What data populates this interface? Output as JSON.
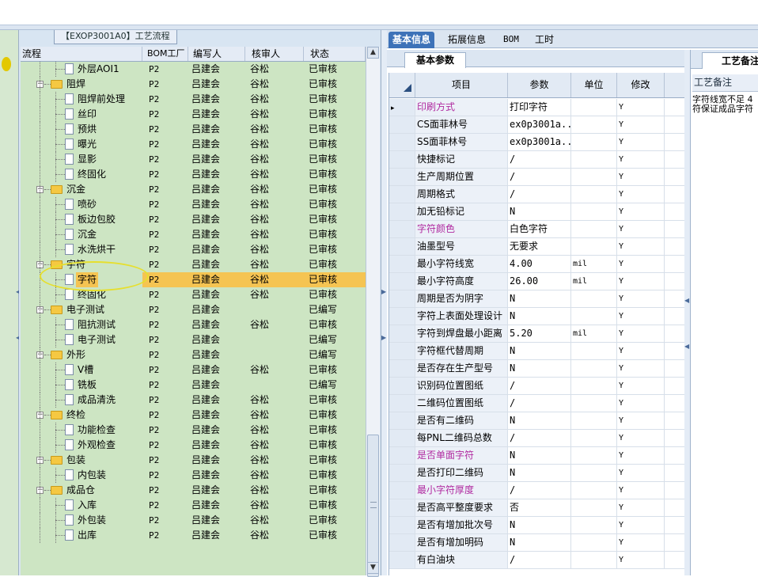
{
  "tree": {
    "title": "【EXOP3001A0】工艺流程",
    "columns": [
      "流程",
      "BOM工厂",
      "编写人",
      "核审人",
      "状态"
    ],
    "rows": [
      {
        "label": "外层AOI1",
        "level": 2,
        "type": "doc",
        "factory": "P2",
        "writer": "吕建会",
        "reviewer": "谷松",
        "status": "已审核"
      },
      {
        "label": "阻焊",
        "level": 1,
        "type": "folder",
        "factory": "P2",
        "writer": "吕建会",
        "reviewer": "谷松",
        "status": "已审核"
      },
      {
        "label": "阻焊前处理",
        "level": 2,
        "type": "doc",
        "factory": "P2",
        "writer": "吕建会",
        "reviewer": "谷松",
        "status": "已审核"
      },
      {
        "label": "丝印",
        "level": 2,
        "type": "doc",
        "factory": "P2",
        "writer": "吕建会",
        "reviewer": "谷松",
        "status": "已审核"
      },
      {
        "label": "预烘",
        "level": 2,
        "type": "doc",
        "factory": "P2",
        "writer": "吕建会",
        "reviewer": "谷松",
        "status": "已审核"
      },
      {
        "label": "曝光",
        "level": 2,
        "type": "doc",
        "factory": "P2",
        "writer": "吕建会",
        "reviewer": "谷松",
        "status": "已审核"
      },
      {
        "label": "显影",
        "level": 2,
        "type": "doc",
        "factory": "P2",
        "writer": "吕建会",
        "reviewer": "谷松",
        "status": "已审核"
      },
      {
        "label": "终固化",
        "level": 2,
        "type": "doc",
        "factory": "P2",
        "writer": "吕建会",
        "reviewer": "谷松",
        "status": "已审核"
      },
      {
        "label": "沉金",
        "level": 1,
        "type": "folder",
        "factory": "P2",
        "writer": "吕建会",
        "reviewer": "谷松",
        "status": "已审核"
      },
      {
        "label": "喷砂",
        "level": 2,
        "type": "doc",
        "factory": "P2",
        "writer": "吕建会",
        "reviewer": "谷松",
        "status": "已审核"
      },
      {
        "label": "板边包胶",
        "level": 2,
        "type": "doc",
        "factory": "P2",
        "writer": "吕建会",
        "reviewer": "谷松",
        "status": "已审核"
      },
      {
        "label": "沉金",
        "level": 2,
        "type": "doc",
        "factory": "P2",
        "writer": "吕建会",
        "reviewer": "谷松",
        "status": "已审核"
      },
      {
        "label": "水洗烘干",
        "level": 2,
        "type": "doc",
        "factory": "P2",
        "writer": "吕建会",
        "reviewer": "谷松",
        "status": "已审核"
      },
      {
        "label": "字符",
        "level": 1,
        "type": "folder",
        "factory": "P2",
        "writer": "吕建会",
        "reviewer": "谷松",
        "status": "已审核"
      },
      {
        "label": "字符",
        "level": 2,
        "type": "doc",
        "factory": "P2",
        "writer": "吕建会",
        "reviewer": "谷松",
        "status": "已审核",
        "selected": true
      },
      {
        "label": "终固化",
        "level": 2,
        "type": "doc",
        "factory": "P2",
        "writer": "吕建会",
        "reviewer": "谷松",
        "status": "已审核"
      },
      {
        "label": "电子测试",
        "level": 1,
        "type": "folder",
        "factory": "P2",
        "writer": "吕建会",
        "reviewer": "",
        "status": "已编写"
      },
      {
        "label": "阻抗测试",
        "level": 2,
        "type": "doc",
        "factory": "P2",
        "writer": "吕建会",
        "reviewer": "谷松",
        "status": "已审核"
      },
      {
        "label": "电子测试",
        "level": 2,
        "type": "doc",
        "factory": "P2",
        "writer": "吕建会",
        "reviewer": "",
        "status": "已编写"
      },
      {
        "label": "外形",
        "level": 1,
        "type": "folder",
        "factory": "P2",
        "writer": "吕建会",
        "reviewer": "",
        "status": "已编写"
      },
      {
        "label": "V槽",
        "level": 2,
        "type": "doc",
        "factory": "P2",
        "writer": "吕建会",
        "reviewer": "谷松",
        "status": "已审核"
      },
      {
        "label": "铣板",
        "level": 2,
        "type": "doc",
        "factory": "P2",
        "writer": "吕建会",
        "reviewer": "",
        "status": "已编写"
      },
      {
        "label": "成品清洗",
        "level": 2,
        "type": "doc",
        "factory": "P2",
        "writer": "吕建会",
        "reviewer": "谷松",
        "status": "已审核"
      },
      {
        "label": "终检",
        "level": 1,
        "type": "folder",
        "factory": "P2",
        "writer": "吕建会",
        "reviewer": "谷松",
        "status": "已审核"
      },
      {
        "label": "功能检查",
        "level": 2,
        "type": "doc",
        "factory": "P2",
        "writer": "吕建会",
        "reviewer": "谷松",
        "status": "已审核"
      },
      {
        "label": "外观检查",
        "level": 2,
        "type": "doc",
        "factory": "P2",
        "writer": "吕建会",
        "reviewer": "谷松",
        "status": "已审核"
      },
      {
        "label": "包装",
        "level": 1,
        "type": "folder",
        "factory": "P2",
        "writer": "吕建会",
        "reviewer": "谷松",
        "status": "已审核"
      },
      {
        "label": "内包装",
        "level": 2,
        "type": "doc",
        "factory": "P2",
        "writer": "吕建会",
        "reviewer": "谷松",
        "status": "已审核"
      },
      {
        "label": "成品仓",
        "level": 1,
        "type": "folder",
        "factory": "P2",
        "writer": "吕建会",
        "reviewer": "谷松",
        "status": "已审核"
      },
      {
        "label": "入库",
        "level": 2,
        "type": "doc",
        "factory": "P2",
        "writer": "吕建会",
        "reviewer": "谷松",
        "status": "已审核"
      },
      {
        "label": "外包装",
        "level": 2,
        "type": "doc",
        "factory": "P2",
        "writer": "吕建会",
        "reviewer": "谷松",
        "status": "已审核"
      },
      {
        "label": "出库",
        "level": 2,
        "type": "doc",
        "factory": "P2",
        "writer": "吕建会",
        "reviewer": "谷松",
        "status": "已审核"
      }
    ]
  },
  "tabs": [
    "基本信息",
    "拓展信息",
    "BOM",
    "工时"
  ],
  "basic": {
    "subtab": "基本参数",
    "columns": [
      "项目",
      "参数",
      "单位",
      "修改"
    ],
    "rows": [
      {
        "item": "印刷方式",
        "param": "打印字符",
        "unit": "",
        "edit": "Y",
        "pink": true,
        "current": true
      },
      {
        "item": "CS面菲林号",
        "param": "ex0p3001a...",
        "unit": "",
        "edit": "Y"
      },
      {
        "item": "SS面菲林号",
        "param": "ex0p3001a...",
        "unit": "",
        "edit": "Y"
      },
      {
        "item": "快捷标记",
        "param": "/",
        "unit": "",
        "edit": "Y"
      },
      {
        "item": "生产周期位置",
        "param": "/",
        "unit": "",
        "edit": "Y"
      },
      {
        "item": "周期格式",
        "param": "/",
        "unit": "",
        "edit": "Y"
      },
      {
        "item": "加无铅标记",
        "param": "N",
        "unit": "",
        "edit": "Y"
      },
      {
        "item": "字符颜色",
        "param": "白色字符",
        "unit": "",
        "edit": "Y",
        "pink": true
      },
      {
        "item": "油墨型号",
        "param": "无要求",
        "unit": "",
        "edit": "Y"
      },
      {
        "item": "最小字符线宽",
        "param": "4.00",
        "unit": "mil",
        "edit": "Y"
      },
      {
        "item": "最小字符高度",
        "param": "26.00",
        "unit": "mil",
        "edit": "Y"
      },
      {
        "item": "周期是否为阴字",
        "param": "N",
        "unit": "",
        "edit": "Y"
      },
      {
        "item": "字符上表面处理设计",
        "param": "N",
        "unit": "",
        "edit": "Y"
      },
      {
        "item": "字符到焊盘最小距离",
        "param": "5.20",
        "unit": "mil",
        "edit": "Y"
      },
      {
        "item": "字符框代替周期",
        "param": "N",
        "unit": "",
        "edit": "Y"
      },
      {
        "item": "是否存在生产型号",
        "param": "N",
        "unit": "",
        "edit": "Y"
      },
      {
        "item": "识别码位置图纸",
        "param": "/",
        "unit": "",
        "edit": "Y"
      },
      {
        "item": "二维码位置图纸",
        "param": "/",
        "unit": "",
        "edit": "Y"
      },
      {
        "item": "是否有二维码",
        "param": "N",
        "unit": "",
        "edit": "Y"
      },
      {
        "item": "每PNL二维码总数",
        "param": "/",
        "unit": "",
        "edit": "Y"
      },
      {
        "item": "是否单面字符",
        "param": "N",
        "unit": "",
        "edit": "Y",
        "pink": true
      },
      {
        "item": "是否打印二维码",
        "param": "N",
        "unit": "",
        "edit": "Y"
      },
      {
        "item": "最小字符厚度",
        "param": "/",
        "unit": "",
        "edit": "Y",
        "pink": true
      },
      {
        "item": "是否高平整度要求",
        "param": "否",
        "unit": "",
        "edit": "Y"
      },
      {
        "item": "是否有增加批次号",
        "param": "N",
        "unit": "",
        "edit": "Y"
      },
      {
        "item": "是否有增加明码",
        "param": "N",
        "unit": "",
        "edit": "Y"
      },
      {
        "item": "有白油块",
        "param": "/",
        "unit": "",
        "edit": "Y"
      }
    ]
  },
  "notes": {
    "tab": "工艺备注",
    "label": "工艺备注",
    "text_lines": [
      "字符线宽不足 4",
      "符保证成品字符"
    ]
  },
  "colors": {
    "tree_bg": "#cde5c3",
    "selection": "#f5c452",
    "active_tab": "#3d72b8",
    "highlight_text": "#b02aa0"
  },
  "icons": [
    "folder-icon",
    "document-icon",
    "expand-minus-icon",
    "scroll-up-icon",
    "scroll-down-icon",
    "row-pointer-icon",
    "sort-indicator-icon"
  ]
}
